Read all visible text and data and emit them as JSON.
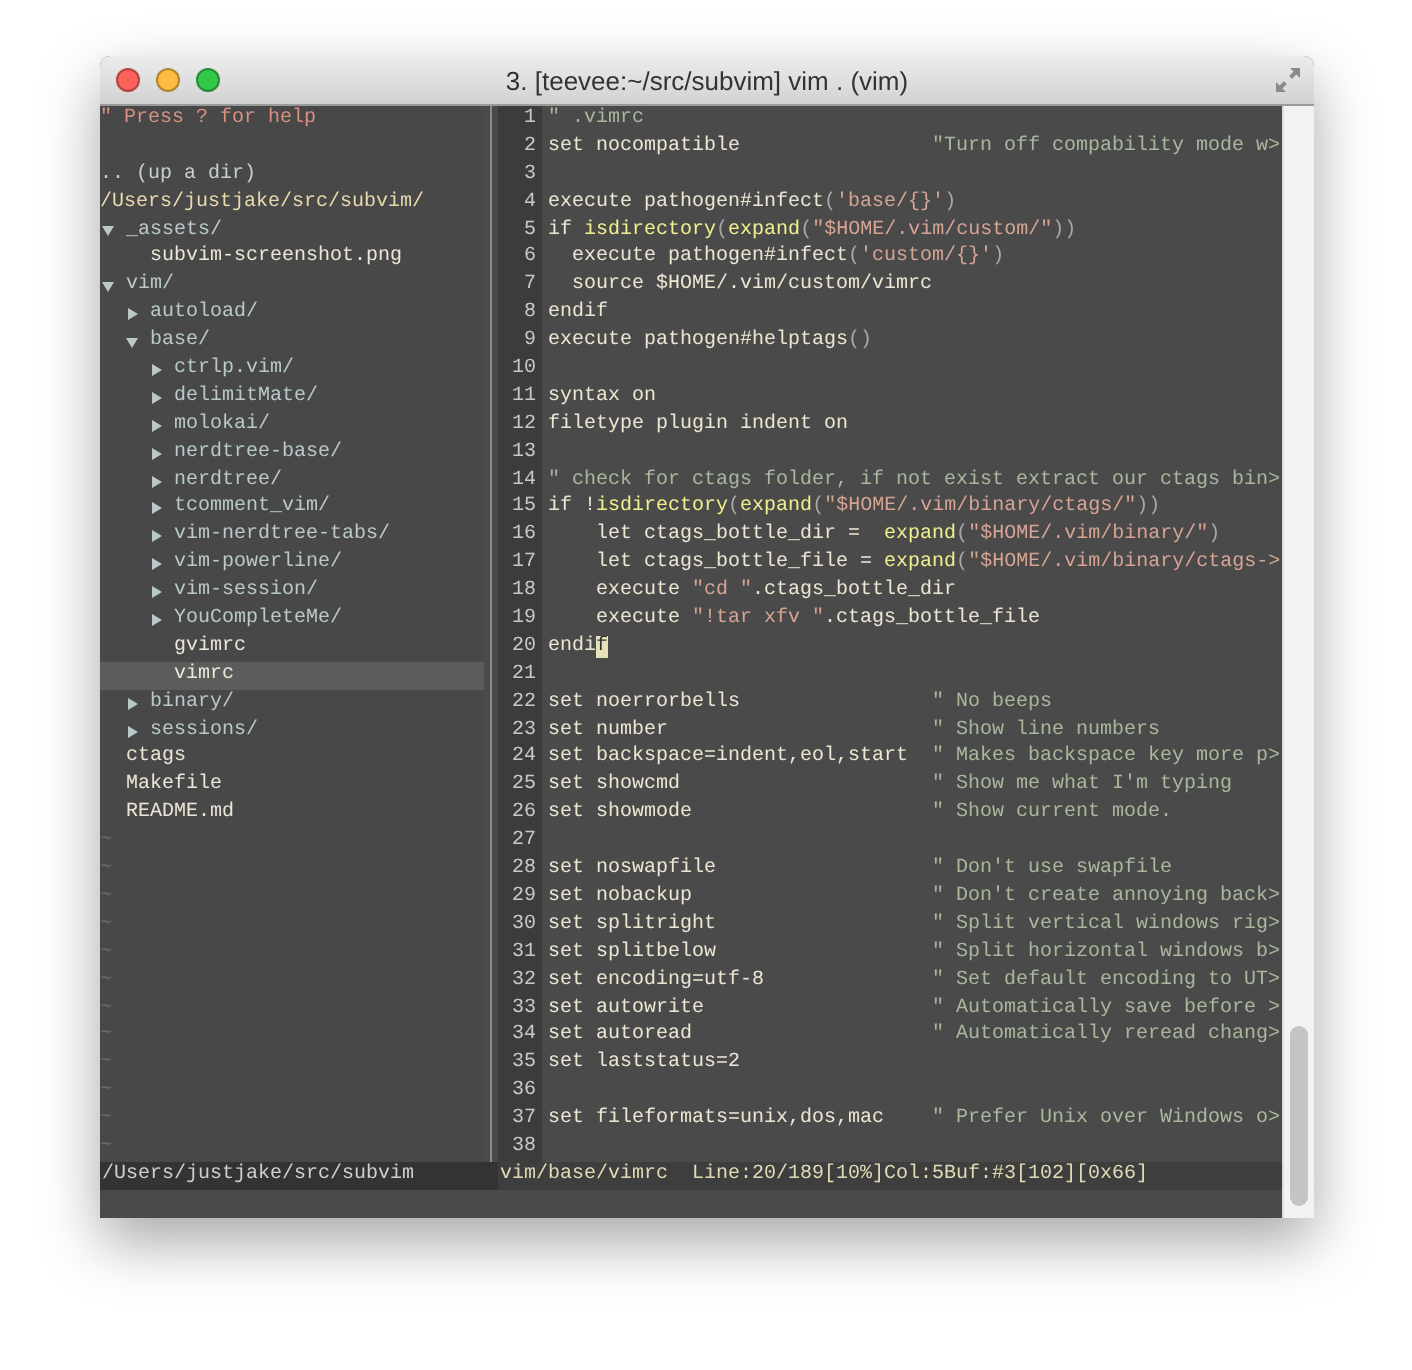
{
  "window": {
    "title": "3. [teevee:~/src/subvim] vim . (vim)"
  },
  "tree_pane": {
    "help": "\" Press ? for help",
    "up_dir": ".. (up a dir)",
    "root": "/Users/justjake/src/subvim/",
    "items": [
      {
        "label": "_assets/",
        "expanded": true,
        "selected": false,
        "children": [
          {
            "label": "subvim-screenshot.png",
            "selected": false
          }
        ]
      },
      {
        "label": "vim/",
        "expanded": true,
        "selected": false,
        "children": [
          {
            "label": "autoload/",
            "expanded": false,
            "selected": false
          },
          {
            "label": "base/",
            "expanded": true,
            "selected": false,
            "children": [
              {
                "label": "ctrlp.vim/",
                "expanded": false,
                "selected": false
              },
              {
                "label": "delimitMate/",
                "expanded": false,
                "selected": false
              },
              {
                "label": "molokai/",
                "expanded": false,
                "selected": false
              },
              {
                "label": "nerdtree-base/",
                "expanded": false,
                "selected": false
              },
              {
                "label": "nerdtree/",
                "expanded": false,
                "selected": false
              },
              {
                "label": "tcomment_vim/",
                "expanded": false,
                "selected": false
              },
              {
                "label": "vim-nerdtree-tabs/",
                "expanded": false,
                "selected": false
              },
              {
                "label": "vim-powerline/",
                "expanded": false,
                "selected": false
              },
              {
                "label": "vim-session/",
                "expanded": false,
                "selected": false
              },
              {
                "label": "YouCompleteMe/",
                "expanded": false,
                "selected": false
              },
              {
                "label": "gvimrc",
                "selected": false
              },
              {
                "label": "vimrc",
                "selected": true
              }
            ]
          },
          {
            "label": "binary/",
            "expanded": false,
            "selected": false
          },
          {
            "label": "sessions/",
            "expanded": false,
            "selected": false
          }
        ]
      },
      {
        "label": "ctags",
        "selected": false
      },
      {
        "label": "Makefile",
        "selected": false
      },
      {
        "label": "README.md",
        "selected": false
      }
    ],
    "empty_lines": [
      "~",
      "~",
      "~",
      "~",
      "~",
      "~",
      "~",
      "~",
      "~",
      "~",
      "~",
      "~"
    ]
  },
  "code_lines": [
    {
      "number": "1",
      "code": [
        {
          "text": "\" .vimrc",
          "kind": "comment"
        }
      ]
    },
    {
      "number": "2",
      "code": [
        {
          "text": "set nocompatible",
          "kind": "plain"
        }
      ],
      "comment": "\"Turn off compability mode w>"
    },
    {
      "number": "3"
    },
    {
      "number": "4",
      "code": [
        {
          "text": "execute pathogen#infect",
          "kind": "plain"
        },
        {
          "text": "(",
          "kind": "paren"
        },
        {
          "text": "'base/{}'",
          "kind": "string"
        },
        {
          "text": ")",
          "kind": "paren"
        }
      ]
    },
    {
      "number": "5",
      "code": [
        {
          "text": "if ",
          "kind": "plain"
        },
        {
          "text": "isdirectory",
          "kind": "function"
        },
        {
          "text": "(",
          "kind": "paren"
        },
        {
          "text": "expand",
          "kind": "function"
        },
        {
          "text": "(",
          "kind": "paren"
        },
        {
          "text": "\"$HOME/.vim/custom/\"",
          "kind": "string"
        },
        {
          "text": "))",
          "kind": "paren"
        }
      ]
    },
    {
      "number": "6",
      "code": [
        {
          "text": "  execute pathogen#infect",
          "kind": "plain"
        },
        {
          "text": "(",
          "kind": "paren"
        },
        {
          "text": "'custom/{}'",
          "kind": "string"
        },
        {
          "text": ")",
          "kind": "paren"
        }
      ]
    },
    {
      "number": "7",
      "code": [
        {
          "text": "  source $HOME/.vim/custom/vimrc",
          "kind": "plain"
        }
      ]
    },
    {
      "number": "8",
      "code": [
        {
          "text": "endif",
          "kind": "plain"
        }
      ]
    },
    {
      "number": "9",
      "code": [
        {
          "text": "execute pathogen#helptags",
          "kind": "plain"
        },
        {
          "text": "()",
          "kind": "paren"
        }
      ]
    },
    {
      "number": "10"
    },
    {
      "number": "11",
      "code": [
        {
          "text": "syntax on",
          "kind": "plain"
        }
      ]
    },
    {
      "number": "12",
      "code": [
        {
          "text": "filetype plugin indent on",
          "kind": "plain"
        }
      ]
    },
    {
      "number": "13"
    },
    {
      "number": "14",
      "code": [
        {
          "text": "\" check for ctags folder, if not exist extract our ctags bin>",
          "kind": "comment"
        }
      ]
    },
    {
      "number": "15",
      "code": [
        {
          "text": "if !",
          "kind": "plain"
        },
        {
          "text": "isdirectory",
          "kind": "function"
        },
        {
          "text": "(",
          "kind": "paren"
        },
        {
          "text": "expand",
          "kind": "function"
        },
        {
          "text": "(",
          "kind": "paren"
        },
        {
          "text": "\"$HOME/.vim/binary/ctags/\"",
          "kind": "string"
        },
        {
          "text": "))",
          "kind": "paren"
        }
      ]
    },
    {
      "number": "16",
      "code": [
        {
          "text": "    let ctags_bottle_dir =  ",
          "kind": "plain"
        },
        {
          "text": "expand",
          "kind": "function"
        },
        {
          "text": "(",
          "kind": "paren"
        },
        {
          "text": "\"$HOME/.vim/binary/\"",
          "kind": "string"
        },
        {
          "text": ")",
          "kind": "paren"
        }
      ]
    },
    {
      "number": "17",
      "code": [
        {
          "text": "    let ctags_bottle_file = ",
          "kind": "plain"
        },
        {
          "text": "expand",
          "kind": "function"
        },
        {
          "text": "(",
          "kind": "paren"
        },
        {
          "text": "\"$HOME/.vim/binary/ctags->",
          "kind": "string"
        }
      ]
    },
    {
      "number": "18",
      "code": [
        {
          "text": "    execute ",
          "kind": "plain"
        },
        {
          "text": "\"cd \"",
          "kind": "string"
        },
        {
          "text": ".ctags_bottle_dir",
          "kind": "plain"
        }
      ]
    },
    {
      "number": "19",
      "code": [
        {
          "text": "    execute ",
          "kind": "plain"
        },
        {
          "text": "\"!tar xfv \"",
          "kind": "string"
        },
        {
          "text": ".ctags_bottle_file",
          "kind": "plain"
        }
      ]
    },
    {
      "number": "20",
      "code": [
        {
          "text": "endi",
          "kind": "plain"
        },
        {
          "text": "f",
          "kind": "cursor"
        }
      ]
    },
    {
      "number": "21"
    },
    {
      "number": "22",
      "code": [
        {
          "text": "set noerrorbells",
          "kind": "plain"
        }
      ],
      "comment": "\" No beeps"
    },
    {
      "number": "23",
      "code": [
        {
          "text": "set number",
          "kind": "plain"
        }
      ],
      "comment": "\" Show line numbers"
    },
    {
      "number": "24",
      "code": [
        {
          "text": "set backspace=indent,eol,start",
          "kind": "plain"
        }
      ],
      "comment": "\" Makes backspace key more p>"
    },
    {
      "number": "25",
      "code": [
        {
          "text": "set showcmd",
          "kind": "plain"
        }
      ],
      "comment": "\" Show me what I'm typing"
    },
    {
      "number": "26",
      "code": [
        {
          "text": "set showmode",
          "kind": "plain"
        }
      ],
      "comment": "\" Show current mode."
    },
    {
      "number": "27"
    },
    {
      "number": "28",
      "code": [
        {
          "text": "set noswapfile",
          "kind": "plain"
        }
      ],
      "comment": "\" Don't use swapfile"
    },
    {
      "number": "29",
      "code": [
        {
          "text": "set nobackup",
          "kind": "plain"
        }
      ],
      "comment": "\" Don't create annoying back>"
    },
    {
      "number": "30",
      "code": [
        {
          "text": "set splitright",
          "kind": "plain"
        }
      ],
      "comment": "\" Split vertical windows rig>"
    },
    {
      "number": "31",
      "code": [
        {
          "text": "set splitbelow",
          "kind": "plain"
        }
      ],
      "comment": "\" Split horizontal windows b>"
    },
    {
      "number": "32",
      "code": [
        {
          "text": "set encoding=utf-8",
          "kind": "plain"
        }
      ],
      "comment": "\" Set default encoding to UT>"
    },
    {
      "number": "33",
      "code": [
        {
          "text": "set autowrite",
          "kind": "plain"
        }
      ],
      "comment": "\" Automatically save before >"
    },
    {
      "number": "34",
      "code": [
        {
          "text": "set autoread",
          "kind": "plain"
        }
      ],
      "comment": "\" Automatically reread chang>"
    },
    {
      "number": "35",
      "code": [
        {
          "text": "set laststatus=2",
          "kind": "plain"
        }
      ]
    },
    {
      "number": "36"
    },
    {
      "number": "37",
      "code": [
        {
          "text": "set fileformats=unix,dos,mac",
          "kind": "plain"
        }
      ],
      "comment": "\" Prefer Unix over Windows o>"
    },
    {
      "number": "38"
    }
  ],
  "status_bar": {
    "tree_path": "/Users/justjake/src/subvim",
    "file": "vim/base/vimrc",
    "position": "Line:20/189[10%]Col:5Buf:#3[102][0x66]"
  }
}
